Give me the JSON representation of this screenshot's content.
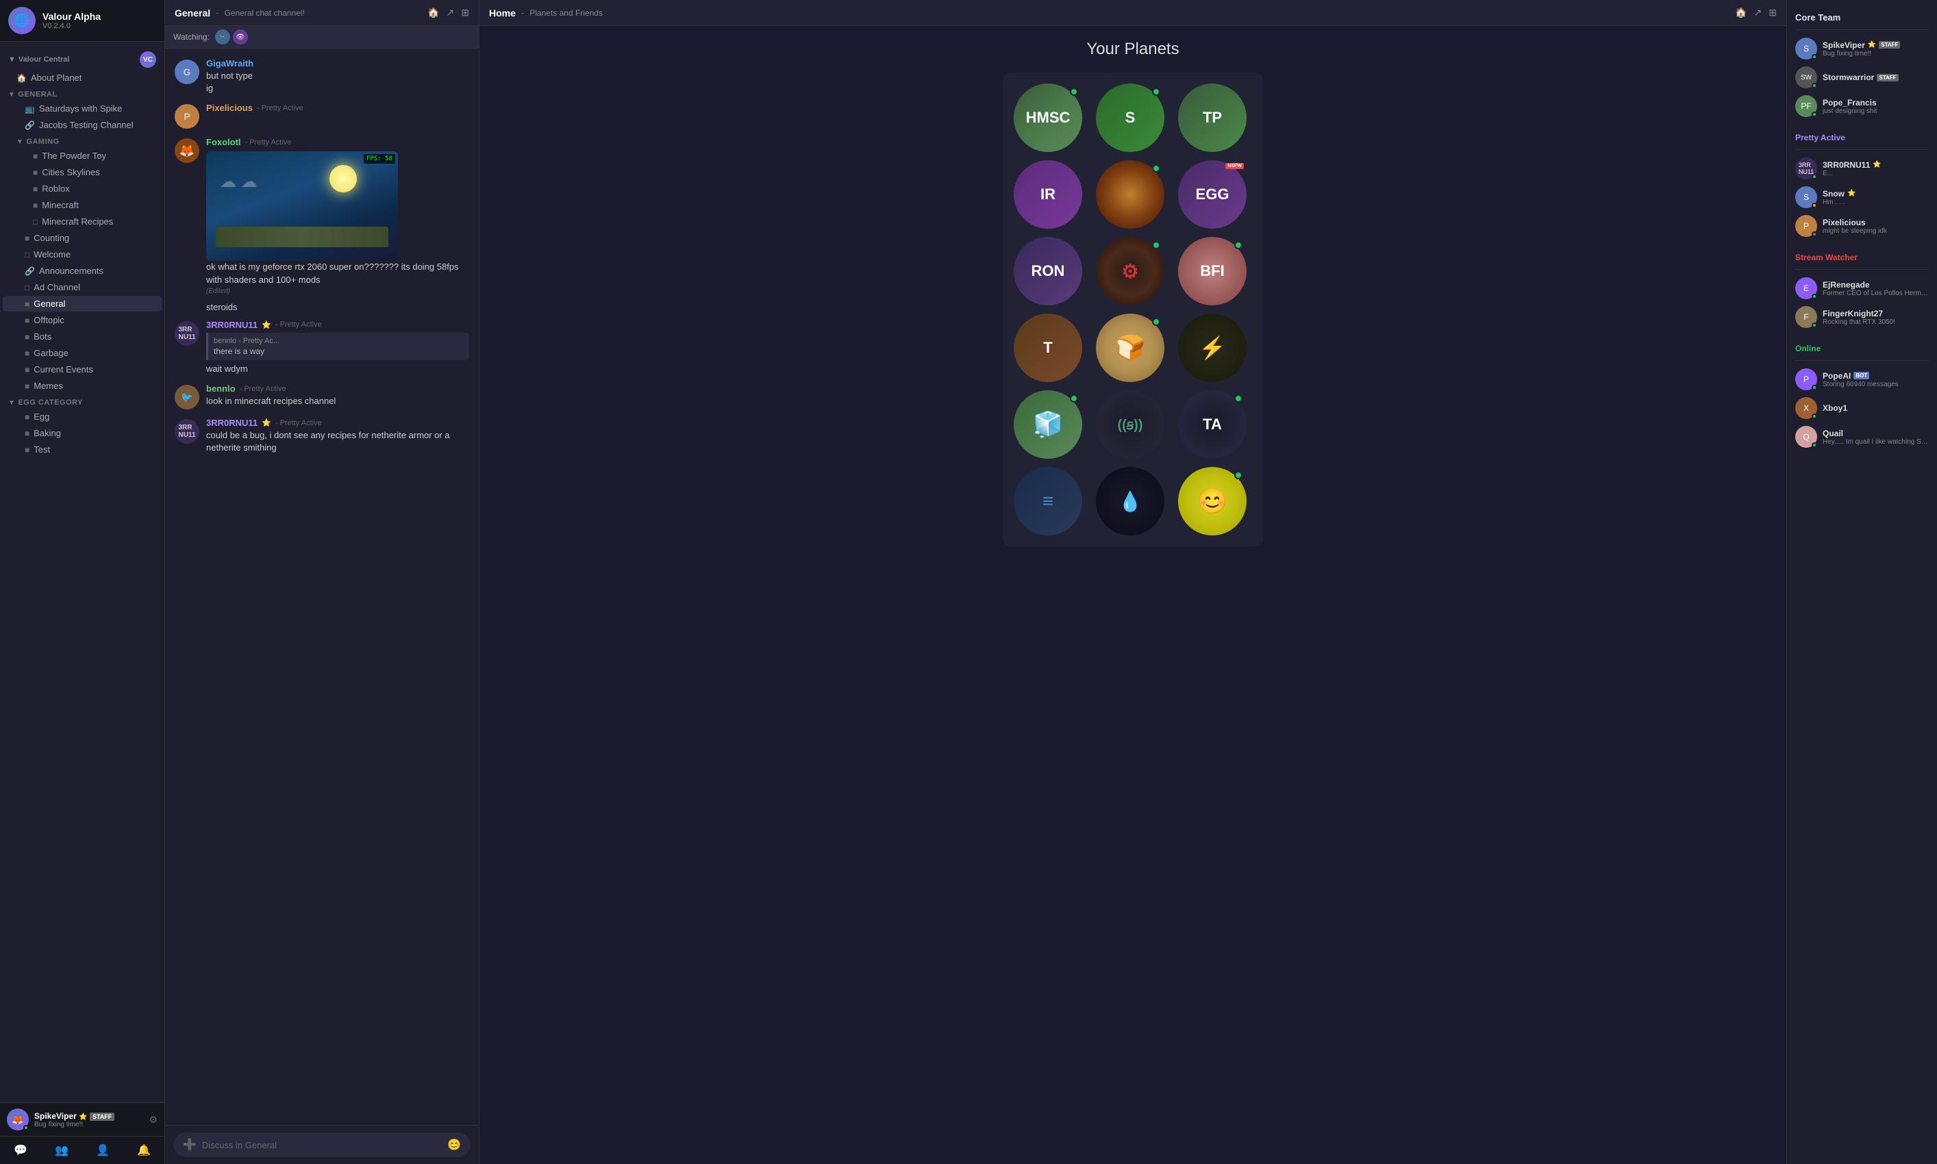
{
  "app": {
    "name": "Valour Alpha",
    "version": "V0.2.4.0"
  },
  "sidebar": {
    "server_name": "Valour Central",
    "nav_items": [
      {
        "id": "about-planet",
        "label": "About Planet",
        "icon": "🏠",
        "level": 0,
        "type": "item"
      },
      {
        "id": "general-cat",
        "label": "General",
        "icon": "▼",
        "level": 0,
        "type": "category"
      },
      {
        "id": "saturdays-with-spike",
        "label": "Saturdays with Spike",
        "icon": "📺",
        "level": 1,
        "type": "item"
      },
      {
        "id": "jacobs-testing-channel",
        "label": "Jacobs Testing Channel",
        "icon": "🔗",
        "level": 1,
        "type": "item"
      },
      {
        "id": "gaming-cat",
        "label": "Gaming",
        "icon": "▼",
        "level": 1,
        "type": "category"
      },
      {
        "id": "the-powder-toy",
        "label": "The Powder Toy",
        "icon": "■",
        "level": 2,
        "type": "item"
      },
      {
        "id": "cities-skylines",
        "label": "Cities Skylines",
        "icon": "■",
        "level": 2,
        "type": "item"
      },
      {
        "id": "roblox",
        "label": "Roblox",
        "icon": "■",
        "level": 2,
        "type": "item"
      },
      {
        "id": "minecraft",
        "label": "Minecraft",
        "icon": "■",
        "level": 2,
        "type": "item"
      },
      {
        "id": "minecraft-recipes",
        "label": "Minecraft Recipes",
        "icon": "□",
        "level": 2,
        "type": "item"
      },
      {
        "id": "counting",
        "label": "Counting",
        "icon": "■",
        "level": 1,
        "type": "item"
      },
      {
        "id": "welcome",
        "label": "Welcome",
        "icon": "□",
        "level": 1,
        "type": "item"
      },
      {
        "id": "announcements",
        "label": "Announcements",
        "icon": "🔗",
        "level": 1,
        "type": "item"
      },
      {
        "id": "ad-channel",
        "label": "Ad Channel",
        "icon": "□",
        "level": 1,
        "type": "item"
      },
      {
        "id": "general-channel",
        "label": "General",
        "icon": "■",
        "level": 1,
        "type": "item",
        "active": true
      },
      {
        "id": "offtopic",
        "label": "Offtopic",
        "icon": "■",
        "level": 1,
        "type": "item"
      },
      {
        "id": "bots",
        "label": "Bots",
        "icon": "■",
        "level": 1,
        "type": "item"
      },
      {
        "id": "garbage",
        "label": "Garbage",
        "icon": "■",
        "level": 1,
        "type": "item"
      },
      {
        "id": "current-events",
        "label": "Current Events",
        "icon": "■",
        "level": 1,
        "type": "item"
      },
      {
        "id": "memes",
        "label": "Memes",
        "icon": "■",
        "level": 1,
        "type": "item"
      },
      {
        "id": "egg-category",
        "label": "Egg Category",
        "icon": "▼",
        "level": 0,
        "type": "category"
      },
      {
        "id": "egg",
        "label": "Egg",
        "icon": "■",
        "level": 1,
        "type": "item"
      },
      {
        "id": "baking",
        "label": "Baking",
        "icon": "■",
        "level": 1,
        "type": "item"
      },
      {
        "id": "test",
        "label": "Test",
        "icon": "■",
        "level": 1,
        "type": "item"
      }
    ],
    "footer": {
      "name": "SpikeViper",
      "star": "⭐",
      "badge": "STAFF",
      "status": "Bug fixing time!!"
    },
    "bottom_icons": [
      "💬",
      "👥",
      "👤",
      "🔔"
    ]
  },
  "chat": {
    "channel_name": "General",
    "channel_desc": "General chat channel!",
    "watching_label": "Watching:",
    "messages": [
      {
        "id": "msg1",
        "author": "GigaWraith",
        "avatar_color": "#5b7abf",
        "avatar_char": "G",
        "badge": null,
        "status": null,
        "texts": [
          "but not type",
          "ig"
        ]
      },
      {
        "id": "msg2",
        "author": "Pixelicious",
        "avatar_color": "#c08040",
        "avatar_char": "P",
        "badge": null,
        "status": "Pretty Active",
        "texts": []
      },
      {
        "id": "msg3",
        "author": "Foxolotl",
        "avatar_color": "#8b4513",
        "avatar_char": "F",
        "badge": null,
        "status": "Pretty Active",
        "texts": [
          "ok what is my geforce rtx 2060 super on??????? its doing 58fps with shaders and 100+ mods"
        ],
        "edited": true,
        "has_image": true,
        "fps_text": "FPS: 58"
      },
      {
        "id": "msg4",
        "author": "",
        "texts": [
          "steroids"
        ],
        "simple": true
      },
      {
        "id": "msg5",
        "author": "3RR0RNU11",
        "avatar_color": "#4a3a6a",
        "avatar_char": "3",
        "badge": "⭐",
        "status": "Pretty Active",
        "texts": [
          "wait wdym"
        ],
        "quote": {
          "author": "bennlo - Pretty Ac...",
          "text": "there is a way"
        }
      },
      {
        "id": "msg6",
        "author": "bennlo",
        "avatar_color": "#7a5a3a",
        "avatar_char": "B",
        "badge": null,
        "status": "Pretty Active",
        "texts": [
          "look in minecraft recipes channel"
        ]
      },
      {
        "id": "msg7",
        "author": "3RR0RNU11",
        "avatar_color": "#4a3a6a",
        "avatar_char": "3",
        "badge": "⭐",
        "status": "Pretty Active",
        "texts": [
          "could be a bug, i dont see any recipes for netherite armor or a netherite smithing"
        ]
      }
    ],
    "input_placeholder": "Discuss in General"
  },
  "home": {
    "channel_name": "Home",
    "channel_desc": "Planets and Friends",
    "section_title": "Your Planets",
    "planets": [
      {
        "id": "hmsc",
        "label": "HMSC",
        "class": "planet-hmsc",
        "dot": true
      },
      {
        "id": "s",
        "label": "S",
        "class": "planet-s",
        "dot": true
      },
      {
        "id": "tp",
        "label": "TP",
        "class": "planet-tp",
        "dot": false
      },
      {
        "id": "ir",
        "label": "IR",
        "class": "planet-ir",
        "dot": false
      },
      {
        "id": "amber",
        "label": "",
        "class": "planet-amber",
        "dot": true
      },
      {
        "id": "egg",
        "label": "EGG",
        "class": "planet-egg",
        "dot": false,
        "nsfw": true
      },
      {
        "id": "ron",
        "label": "RON",
        "class": "planet-ron",
        "dot": false
      },
      {
        "id": "gear",
        "label": "⚙",
        "class": "planet-gear",
        "dot": true
      },
      {
        "id": "bfi",
        "label": "BFI",
        "class": "planet-bfi",
        "dot": true
      },
      {
        "id": "t",
        "label": "T",
        "class": "planet-t",
        "dot": false
      },
      {
        "id": "bread",
        "label": "",
        "class": "planet-bread",
        "dot": true
      },
      {
        "id": "bolt",
        "label": "⚡",
        "class": "planet-bolt",
        "dot": false
      },
      {
        "id": "mc",
        "label": "",
        "class": "planet-mc",
        "dot": true
      },
      {
        "id": "wifi",
        "label": "((ꞩ))",
        "class": "planet-wifi",
        "dot": false
      },
      {
        "id": "ta",
        "label": "TA",
        "class": "planet-ta",
        "dot": true
      },
      {
        "id": "layers",
        "label": "",
        "class": "planet-layers",
        "dot": false
      },
      {
        "id": "drop",
        "label": "",
        "class": "planet-drop",
        "dot": false
      },
      {
        "id": "smile",
        "label": "😊",
        "class": "planet-smile",
        "dot": true
      }
    ]
  },
  "right_panel": {
    "sections": [
      {
        "title": "Core Team",
        "type": "core",
        "users": [
          {
            "name": "SpikeViper",
            "star": "⭐",
            "badge": "STAFF",
            "status": "Bug fixing time!!",
            "color": "#5b7abf",
            "char": "S",
            "online": "online"
          },
          {
            "name": "Stormwarrior",
            "badge": "STAFF",
            "status": "",
            "color": "#666",
            "char": "SW",
            "online": "online"
          },
          {
            "name": "Pope_Francis",
            "status": "just designing shit",
            "color": "#5a8a5a",
            "char": "PF",
            "online": "online"
          }
        ]
      },
      {
        "title": "Pretty Active",
        "type": "pretty",
        "users": [
          {
            "name": "3RR0RNU11",
            "star": "⭐",
            "status": "E...",
            "color": "#4a3a6a",
            "char": "3",
            "online": "online"
          },
          {
            "name": "Snow",
            "star": "⭐",
            "status": "Hm . . .",
            "color": "#5b7abf",
            "char": "S",
            "online": "idle"
          },
          {
            "name": "Pixelicious",
            "status": "might be sleeping idk",
            "color": "#c08040",
            "char": "P",
            "online": "offline"
          }
        ]
      },
      {
        "title": "Stream Watcher",
        "type": "stream",
        "users": [
          {
            "name": "EjRenegade",
            "status": "Former CEO of Los Pollos Hermanos on Nerdcraft",
            "color": "#8b5cf6",
            "char": "E",
            "online": "online"
          },
          {
            "name": "FingerKnight27",
            "status": "Rocking that RTX 3050!",
            "color": "#8b7a5a",
            "char": "F",
            "online": "online"
          }
        ]
      },
      {
        "title": "Online",
        "type": "online",
        "users": [
          {
            "name": "PopeAI",
            "bot": true,
            "status": "Storing 66940 messages",
            "color": "#8b5cf6",
            "char": "P",
            "online": "online"
          },
          {
            "name": "Xboy1",
            "status": "",
            "color": "#a06030",
            "char": "X",
            "online": "online"
          },
          {
            "name": "Quail",
            "status": "Hey..... Im quail I like watching Spike when im",
            "color": "#d4a0a0",
            "char": "Q",
            "online": "online"
          }
        ]
      }
    ]
  }
}
